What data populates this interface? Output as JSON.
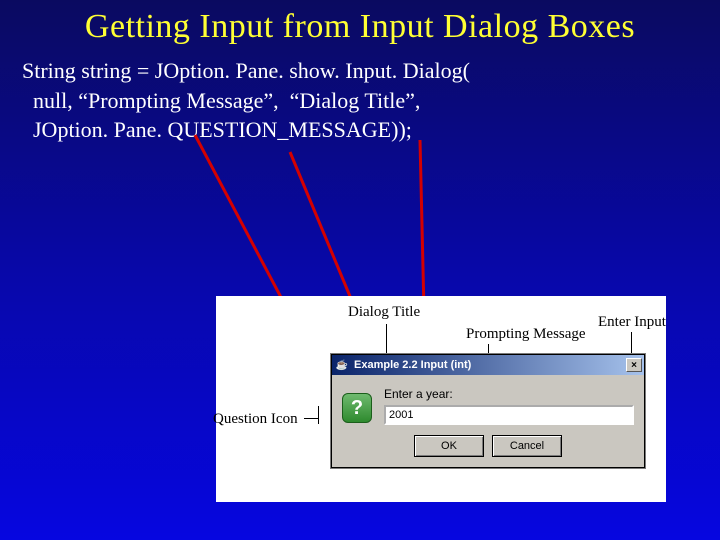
{
  "title": "Getting Input from Input Dialog Boxes",
  "code": {
    "line1": "String string = JOption. Pane. show. Input. Dialog(",
    "line2": "  null, “Prompting Message”,  “Dialog Title”,",
    "line3": "  JOption. Pane. QUESTION_MESSAGE));"
  },
  "labels": {
    "dialog_title": "Dialog Title",
    "prompting_message": "Prompting Message",
    "enter_input": "Enter Input",
    "question_icon": "Question Icon"
  },
  "dialog": {
    "title": "Example 2.2 Input (int)",
    "prompt": "Enter a year:",
    "input_value": "2001",
    "ok": "OK",
    "cancel": "Cancel",
    "close_glyph": "×",
    "question_glyph": "?",
    "java_glyph": "☕"
  }
}
